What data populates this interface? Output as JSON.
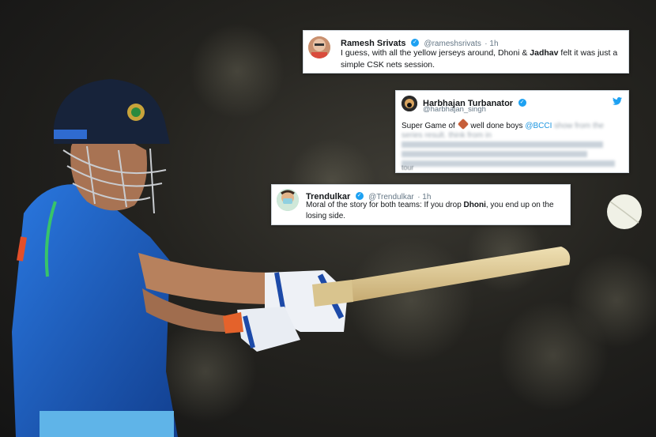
{
  "tweets": [
    {
      "display_name": "Ramesh Srivats",
      "handle": "@rameshsrivats",
      "time": "· 1h",
      "text_parts": [
        "I guess, with all the yellow jerseys around, Dhoni & ",
        "Jadhav",
        " felt it was just a simple CSK nets session."
      ]
    },
    {
      "display_name": "Harbhajan Turbanator",
      "handle": "@harbhajan_singh",
      "text_lead": "Super Game of ",
      "text_mid": " well done boys ",
      "mention": "@BCCI",
      "blurred_text": "show from the series result. think from in",
      "text_end": "tour"
    },
    {
      "display_name": "Trendulkar",
      "handle": "@Trendulkar",
      "time": "· 1h",
      "text_parts": [
        "Moral of the story for both teams: If you drop ",
        "Dhoni",
        ", you end up on the losing side."
      ]
    }
  ],
  "icons": {
    "verified": "verified-badge-icon",
    "twitter": "twitter-bird-icon",
    "cricket_bat": "cricket-bat-emoji-icon"
  },
  "colors": {
    "jersey_blue": "#1f5fc4",
    "verified_blue": "#1da1f2",
    "link_blue": "#1b95e0"
  }
}
